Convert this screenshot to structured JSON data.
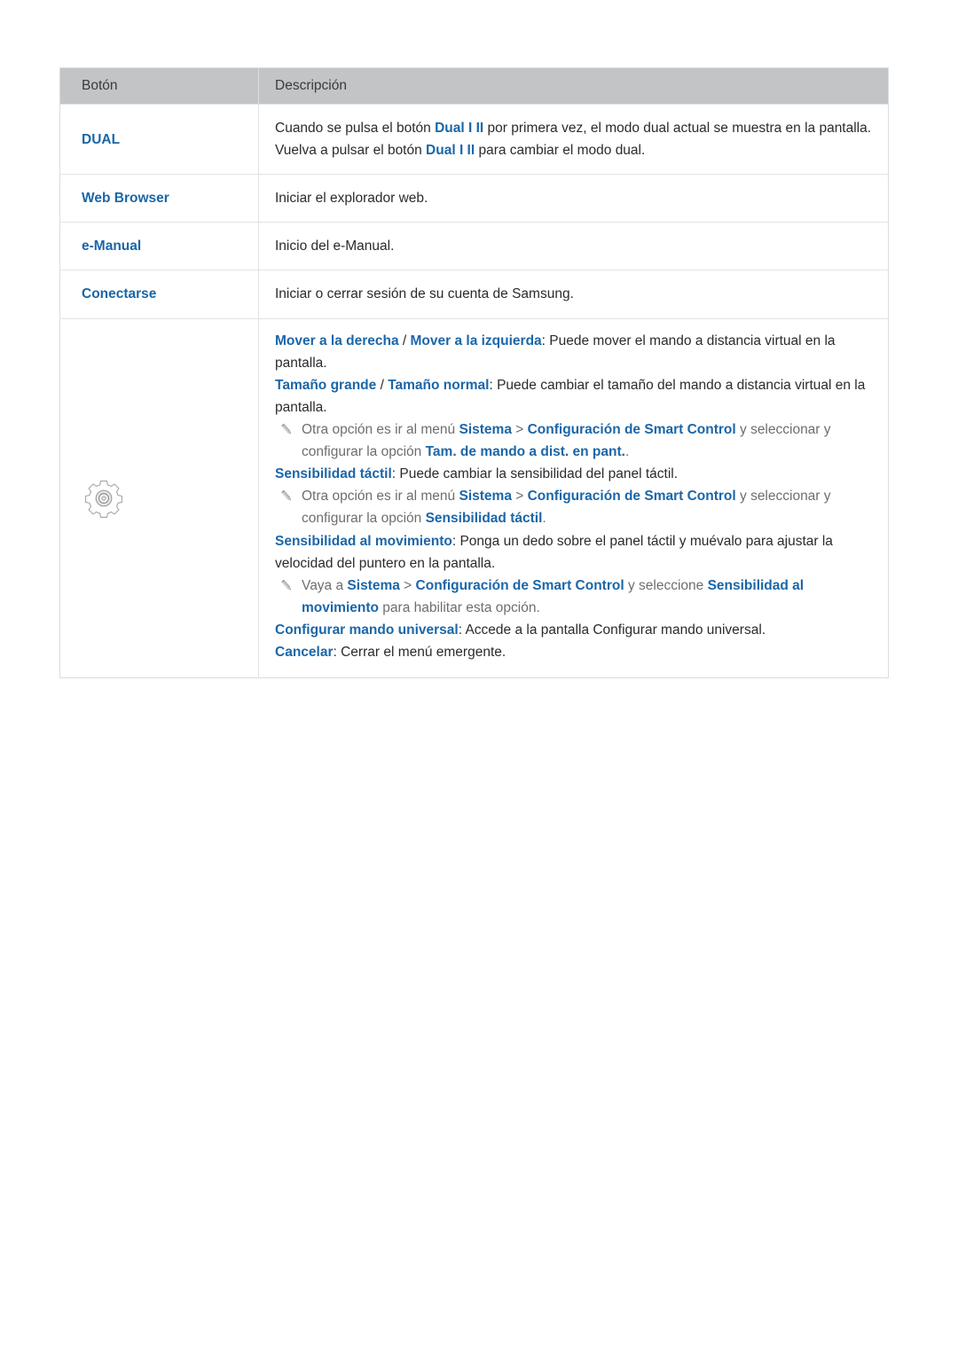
{
  "table": {
    "headers": {
      "button": "Botón",
      "description": "Descripción"
    },
    "rows": [
      {
        "button_label": "DUAL",
        "lines": [
          {
            "segments": [
              {
                "text": "Cuando se pulsa el botón ",
                "style": "plain"
              },
              {
                "text": "Dual I II",
                "style": "bold-blue"
              },
              {
                "text": " por primera vez, el modo dual actual se muestra en la pantalla.",
                "style": "plain"
              }
            ]
          },
          {
            "segments": [
              {
                "text": "Vuelva a pulsar el botón ",
                "style": "plain"
              },
              {
                "text": "Dual I II",
                "style": "bold-blue"
              },
              {
                "text": " para cambiar el modo dual.",
                "style": "plain"
              }
            ]
          }
        ]
      },
      {
        "button_label": "Web Browser",
        "lines": [
          {
            "segments": [
              {
                "text": "Iniciar el explorador web.",
                "style": "plain"
              }
            ]
          }
        ]
      },
      {
        "button_label": "e-Manual",
        "lines": [
          {
            "segments": [
              {
                "text": "Inicio del e-Manual.",
                "style": "plain"
              }
            ]
          }
        ]
      },
      {
        "button_label": "Conectarse",
        "lines": [
          {
            "segments": [
              {
                "text": "Iniciar o cerrar sesión de su cuenta de Samsung.",
                "style": "plain"
              }
            ]
          }
        ]
      }
    ],
    "gear_row": {
      "icon": "gear-icon",
      "blocks": [
        {
          "kind": "text",
          "segments": [
            {
              "text": "Mover a la derecha",
              "style": "bold-blue"
            },
            {
              "text": " / ",
              "style": "plain"
            },
            {
              "text": "Mover a la izquierda",
              "style": "bold-blue"
            },
            {
              "text": ": Puede mover el mando a distancia virtual en la pantalla.",
              "style": "plain"
            }
          ]
        },
        {
          "kind": "text",
          "segments": [
            {
              "text": "Tamaño grande",
              "style": "bold-blue"
            },
            {
              "text": " / ",
              "style": "plain"
            },
            {
              "text": "Tamaño normal",
              "style": "bold-blue"
            },
            {
              "text": ": Puede cambiar el tamaño del mando a distancia virtual en la pantalla.",
              "style": "plain"
            }
          ]
        },
        {
          "kind": "note",
          "segments": [
            {
              "text": "Otra opción es ir al menú ",
              "style": "gray"
            },
            {
              "text": "Sistema",
              "style": "note-bold"
            },
            {
              "text": " > ",
              "style": "gray"
            },
            {
              "text": "Configuración de Smart Control",
              "style": "note-bold"
            },
            {
              "text": " y seleccionar y configurar la opción ",
              "style": "gray"
            },
            {
              "text": "Tam. de mando a dist. en pant.",
              "style": "note-bold"
            },
            {
              "text": ".",
              "style": "gray"
            }
          ]
        },
        {
          "kind": "text",
          "segments": [
            {
              "text": "Sensibilidad táctil",
              "style": "bold-blue"
            },
            {
              "text": ": Puede cambiar la sensibilidad del panel táctil.",
              "style": "plain"
            }
          ]
        },
        {
          "kind": "note",
          "segments": [
            {
              "text": "Otra opción es ir al menú ",
              "style": "gray"
            },
            {
              "text": "Sistema",
              "style": "note-bold"
            },
            {
              "text": " > ",
              "style": "gray"
            },
            {
              "text": "Configuración de Smart Control",
              "style": "note-bold"
            },
            {
              "text": " y seleccionar y configurar la opción ",
              "style": "gray"
            },
            {
              "text": "Sensibilidad táctil",
              "style": "note-bold"
            },
            {
              "text": ".",
              "style": "gray"
            }
          ]
        },
        {
          "kind": "text",
          "segments": [
            {
              "text": "Sensibilidad al movimiento",
              "style": "bold-blue"
            },
            {
              "text": ": Ponga un dedo sobre el panel táctil y muévalo para ajustar la velocidad del puntero en la pantalla.",
              "style": "plain"
            }
          ]
        },
        {
          "kind": "note",
          "segments": [
            {
              "text": "Vaya a ",
              "style": "gray"
            },
            {
              "text": "Sistema",
              "style": "note-bold"
            },
            {
              "text": " > ",
              "style": "gray"
            },
            {
              "text": "Configuración de Smart Control",
              "style": "note-bold"
            },
            {
              "text": " y seleccione ",
              "style": "gray"
            },
            {
              "text": "Sensibilidad al movimiento",
              "style": "note-bold"
            },
            {
              "text": " para habilitar esta opción.",
              "style": "gray"
            }
          ]
        },
        {
          "kind": "text",
          "segments": [
            {
              "text": "Configurar mando universal",
              "style": "bold-blue"
            },
            {
              "text": ": Accede a la pantalla Configurar mando universal.",
              "style": "plain"
            }
          ]
        },
        {
          "kind": "text",
          "segments": [
            {
              "text": "Cancelar",
              "style": "bold-blue"
            },
            {
              "text": ": Cerrar el menú emergente.",
              "style": "plain"
            }
          ]
        }
      ]
    }
  },
  "colors": {
    "accent_blue": "#1b66a8",
    "header_bg": "#c2c4c6",
    "border": "#dfe4e7",
    "note_gray": "#6e6e6e",
    "body_text": "#2b2b2b"
  }
}
